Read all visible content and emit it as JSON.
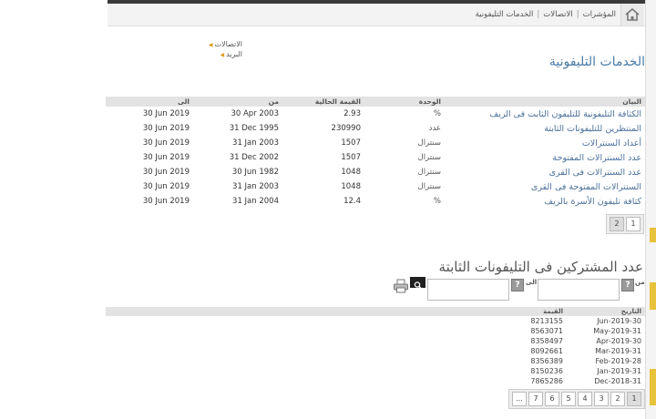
{
  "breadcrumb": [
    "المؤشرات",
    "الاتصالات",
    "الخدمات التليفونية"
  ],
  "side_links": [
    "الاتصالات",
    "البريد"
  ],
  "page_title": "الخدمات التليفونية",
  "indicators_table": {
    "headers": {
      "name": "البيان",
      "unit": "الوحدة",
      "value": "القيمة الحالية",
      "from": "من",
      "to": "الى"
    },
    "rows": [
      {
        "name": "الكثافة التليفونية للتليفون الثابت فى الريف",
        "unit": "%",
        "value": "2.93",
        "from": "30 Apr 2003",
        "to": "30 Jun 2019"
      },
      {
        "name": "المنتظرين للتليفونات الثابتة",
        "unit": "عدد",
        "value": "230990",
        "from": "31 Dec 1995",
        "to": "30 Jun 2019"
      },
      {
        "name": "أعداد السنترالات",
        "unit": "سنترال",
        "value": "1507",
        "from": "31 Jan 2003",
        "to": "30 Jun 2019"
      },
      {
        "name": "عدد السنترالات المفتوحة",
        "unit": "سنترال",
        "value": "1507",
        "from": "31 Dec 2002",
        "to": "30 Jun 2019"
      },
      {
        "name": "عدد السنترالات فى القرى",
        "unit": "سنترال",
        "value": "1048",
        "from": "30 Jun 1982",
        "to": "30 Jun 2019"
      },
      {
        "name": "السنترالات المفتوحة فى القرى",
        "unit": "سنترال",
        "value": "1048",
        "from": "31 Jan 2003",
        "to": "30 Jun 2019"
      },
      {
        "name": "كثافة تليفون الأسرة بالريف",
        "unit": "%",
        "value": "12.4",
        "from": "31 Jan 2004",
        "to": "30 Jun 2019"
      }
    ],
    "pages": [
      "1",
      "2"
    ]
  },
  "section_title": "عدد المشتركين فى التليفونات الثابتة",
  "filters": {
    "from_label": "من",
    "to_label": "الى",
    "help_glyph": "?"
  },
  "icons": {
    "home": "home-icon",
    "search": "search-icon",
    "print": "printer-icon",
    "help": "help-icon"
  },
  "colors": {
    "title_blue": "#4a7ba6",
    "accent_orange": "#e09a1f",
    "rail_yellow": "#e8c23a"
  },
  "subscribers_table": {
    "headers": {
      "date": "التاريخ",
      "value": "القيمة"
    },
    "rows": [
      {
        "date": "Jun-2019-30",
        "value": "8213155"
      },
      {
        "date": "May-2019-31",
        "value": "8563071"
      },
      {
        "date": "Apr-2019-30",
        "value": "8358497"
      },
      {
        "date": "Mar-2019-31",
        "value": "8092661"
      },
      {
        "date": "Feb-2019-28",
        "value": "8356389"
      },
      {
        "date": "Jan-2019-31",
        "value": "8150236"
      },
      {
        "date": "Dec-2018-31",
        "value": "7865286"
      }
    ],
    "pages": [
      "1",
      "2",
      "3",
      "4",
      "5",
      "6",
      "7",
      "..."
    ]
  }
}
